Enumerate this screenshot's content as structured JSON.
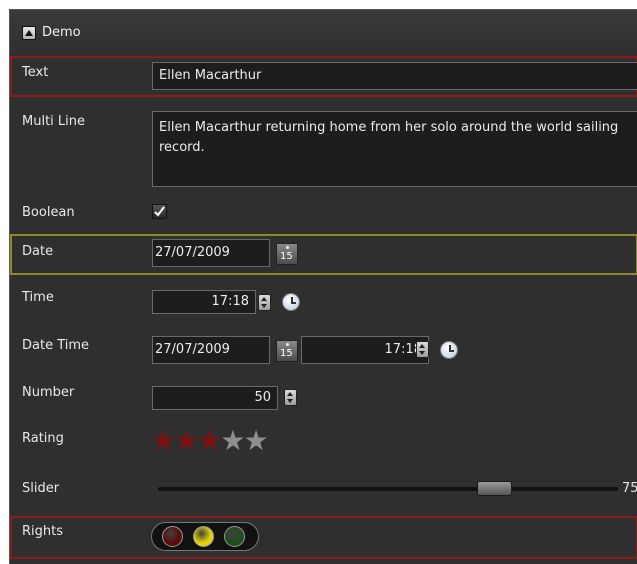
{
  "header": {
    "title": "Demo"
  },
  "fields": {
    "text": {
      "label": "Text",
      "value": "Ellen Macarthur"
    },
    "multiline": {
      "label": "Multi Line",
      "value": "Ellen Macarthur returning home from her solo around the world sailing record."
    },
    "boolean": {
      "label": "Boolean",
      "checked": true
    },
    "date": {
      "label": "Date",
      "value": "27/07/2009",
      "calendar_day": "15"
    },
    "time": {
      "label": "Time",
      "value": "17:18"
    },
    "datetime": {
      "label": "Date Time",
      "date_value": "27/07/2009",
      "calendar_day": "15",
      "time_value": "17:18"
    },
    "number": {
      "label": "Number",
      "value": "50"
    },
    "rating": {
      "label": "Rating",
      "value": 3,
      "max": 5
    },
    "slider": {
      "label": "Slider",
      "value": "75"
    },
    "rights": {
      "label": "Rights",
      "lights": [
        "red",
        "yellow",
        "green"
      ]
    }
  },
  "colors": {
    "panel_bg": "#2f2f2f",
    "highlight_red": "#8a1c1c",
    "highlight_yellow": "#8f8a2a",
    "star_active": "#7e1111",
    "star_inactive": "#8e8e8e",
    "light_red": "#5a0b0b",
    "light_yellow": "#e2d20a",
    "light_green": "#1f4d1f"
  },
  "icons": {
    "collapse": "chevron-up-icon",
    "checkbox": "checkmark-icon",
    "calendar": "calendar-icon",
    "clock": "clock-icon",
    "spinner": "spinner-arrows-icon",
    "star": "star-icon"
  }
}
